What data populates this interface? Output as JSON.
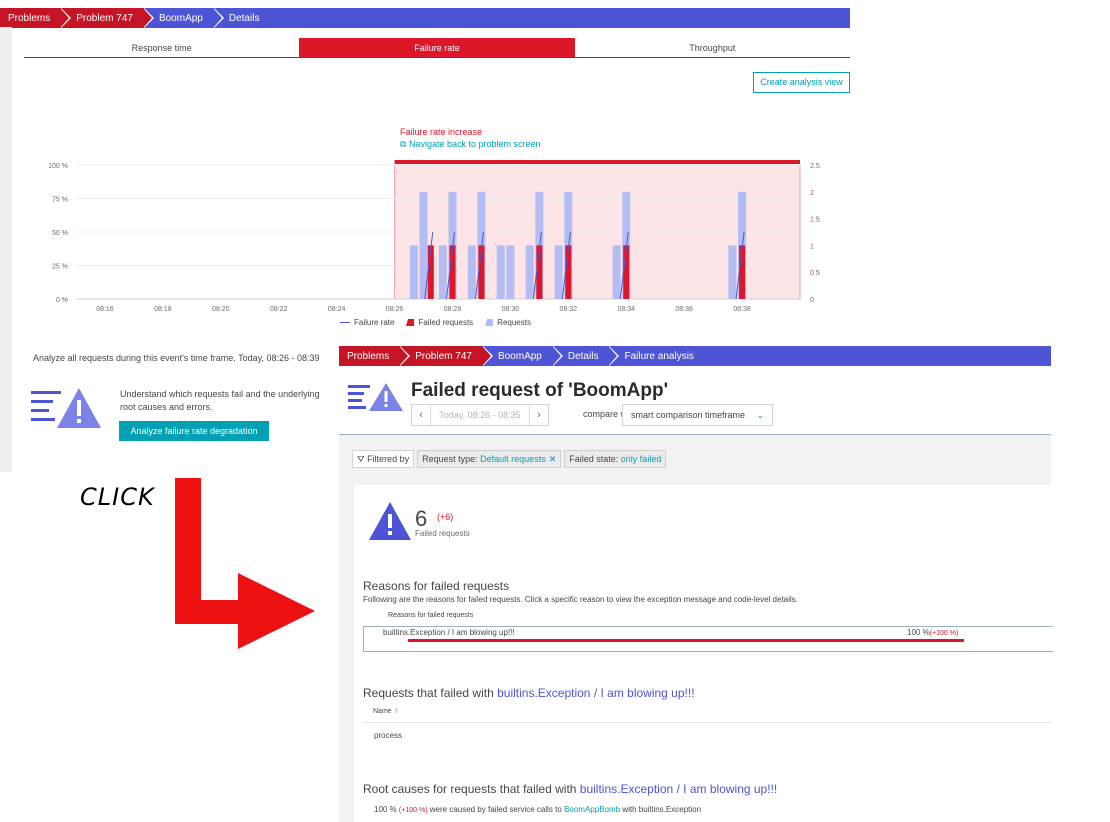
{
  "top": {
    "breadcrumbs": [
      "Problems",
      "Problem 747",
      "BoomApp",
      "Details"
    ],
    "tabs": [
      "Response time",
      "Failure rate",
      "Throughput"
    ],
    "active_tab": "Failure rate",
    "create_button": "Create analysis view",
    "event_title": "Failure rate increase",
    "event_link": "Navigate back to problem screen",
    "legend": [
      "Failure rate",
      "Failed requests",
      "Requests"
    ],
    "analyze_text": "Analyze all requests during this event's time frame. Today, 08:26 - 08:39",
    "promo_text": "Understand which requests fail and the underlying root causes and errors.",
    "analyze_button": "Analyze failure rate degradation"
  },
  "chart_data": {
    "type": "bar",
    "title": "",
    "x_ticks": [
      "08:16",
      "08:18",
      "08:20",
      "08:22",
      "08:24",
      "08:26",
      "08:28",
      "08:30",
      "08:32",
      "08:34",
      "08:36",
      "08:38"
    ],
    "y_left_ticks": [
      "0 %",
      "25 %",
      "50 %",
      "75 %",
      "100 %"
    ],
    "y_right_ticks": [
      "0",
      "0.5",
      "1",
      "1.5",
      "2",
      "2.5"
    ],
    "ylim_left": [
      0,
      100
    ],
    "ylim_right": [
      0,
      2.5
    ],
    "highlight_range": [
      "08:26",
      "08:40"
    ],
    "series": [
      {
        "name": "Requests",
        "color": "#b3bdf4",
        "points": [
          [
            "08:26:40",
            1
          ],
          [
            "08:27:00",
            2
          ],
          [
            "08:27:40",
            1
          ],
          [
            "08:28:00",
            2
          ],
          [
            "08:28:40",
            1
          ],
          [
            "08:29:00",
            2
          ],
          [
            "08:29:40",
            1
          ],
          [
            "08:30:00",
            1
          ],
          [
            "08:30:40",
            1
          ],
          [
            "08:31:00",
            2
          ],
          [
            "08:31:40",
            1
          ],
          [
            "08:32:00",
            2
          ],
          [
            "08:33:40",
            1
          ],
          [
            "08:34:00",
            2
          ],
          [
            "08:37:40",
            1
          ],
          [
            "08:38:00",
            2
          ]
        ]
      },
      {
        "name": "Failed requests",
        "color": "#dc172a",
        "points": [
          [
            "08:27:15",
            1
          ],
          [
            "08:28:00",
            1
          ],
          [
            "08:29:00",
            1
          ],
          [
            "08:31:00",
            1
          ],
          [
            "08:32:00",
            1
          ],
          [
            "08:34:00",
            1
          ],
          [
            "08:38:00",
            1
          ]
        ]
      },
      {
        "name": "Failure rate",
        "color": "#4d54d6"
      }
    ]
  },
  "click_label": "CLICK",
  "bottom": {
    "breadcrumbs": [
      "Problems",
      "Problem 747",
      "BoomApp",
      "Details",
      "Failure analysis"
    ],
    "title": "Failed request of 'BoomApp'",
    "timeframe": "Today, 08:26 - 08:35",
    "compare_label": "compare with",
    "compare_value": "smart comparison timeframe",
    "filtered_by": "Filtered by",
    "chip1_key": "Request type:",
    "chip1_val": "Default requests",
    "chip2_key": "Failed state:",
    "chip2_val": "only failed",
    "failed_count": "6",
    "failed_delta": "(+6)",
    "failed_label": "Failed requests",
    "reasons_title": "Reasons for failed requests",
    "reasons_desc": "Following are the reasons for failed requests. Click a specific reason to view the exception message and code-level details.",
    "reasons_header": "Reasons for failed requests",
    "reason_label": "builtins.Exception / I am blowing up!!!",
    "reason_pct": "100 %",
    "reason_delta": "(+100 %)",
    "reason_share": 1.0,
    "req_title_prefix": "Requests that failed with",
    "req_title_hl": "builtins.Exception / I am blowing up!!!",
    "name_header": "Name",
    "row_name": "process",
    "rc_title_prefix": "Root causes for requests that failed with",
    "rc_title_hl": "builtins.Exception / I am blowing up!!!",
    "rc_pct": "100 %",
    "rc_delta": "(+100 %)",
    "rc_mid": "were caused by failed service calls to",
    "rc_link": "BoomAppBomb",
    "rc_tail": "with builtins.Exception"
  }
}
